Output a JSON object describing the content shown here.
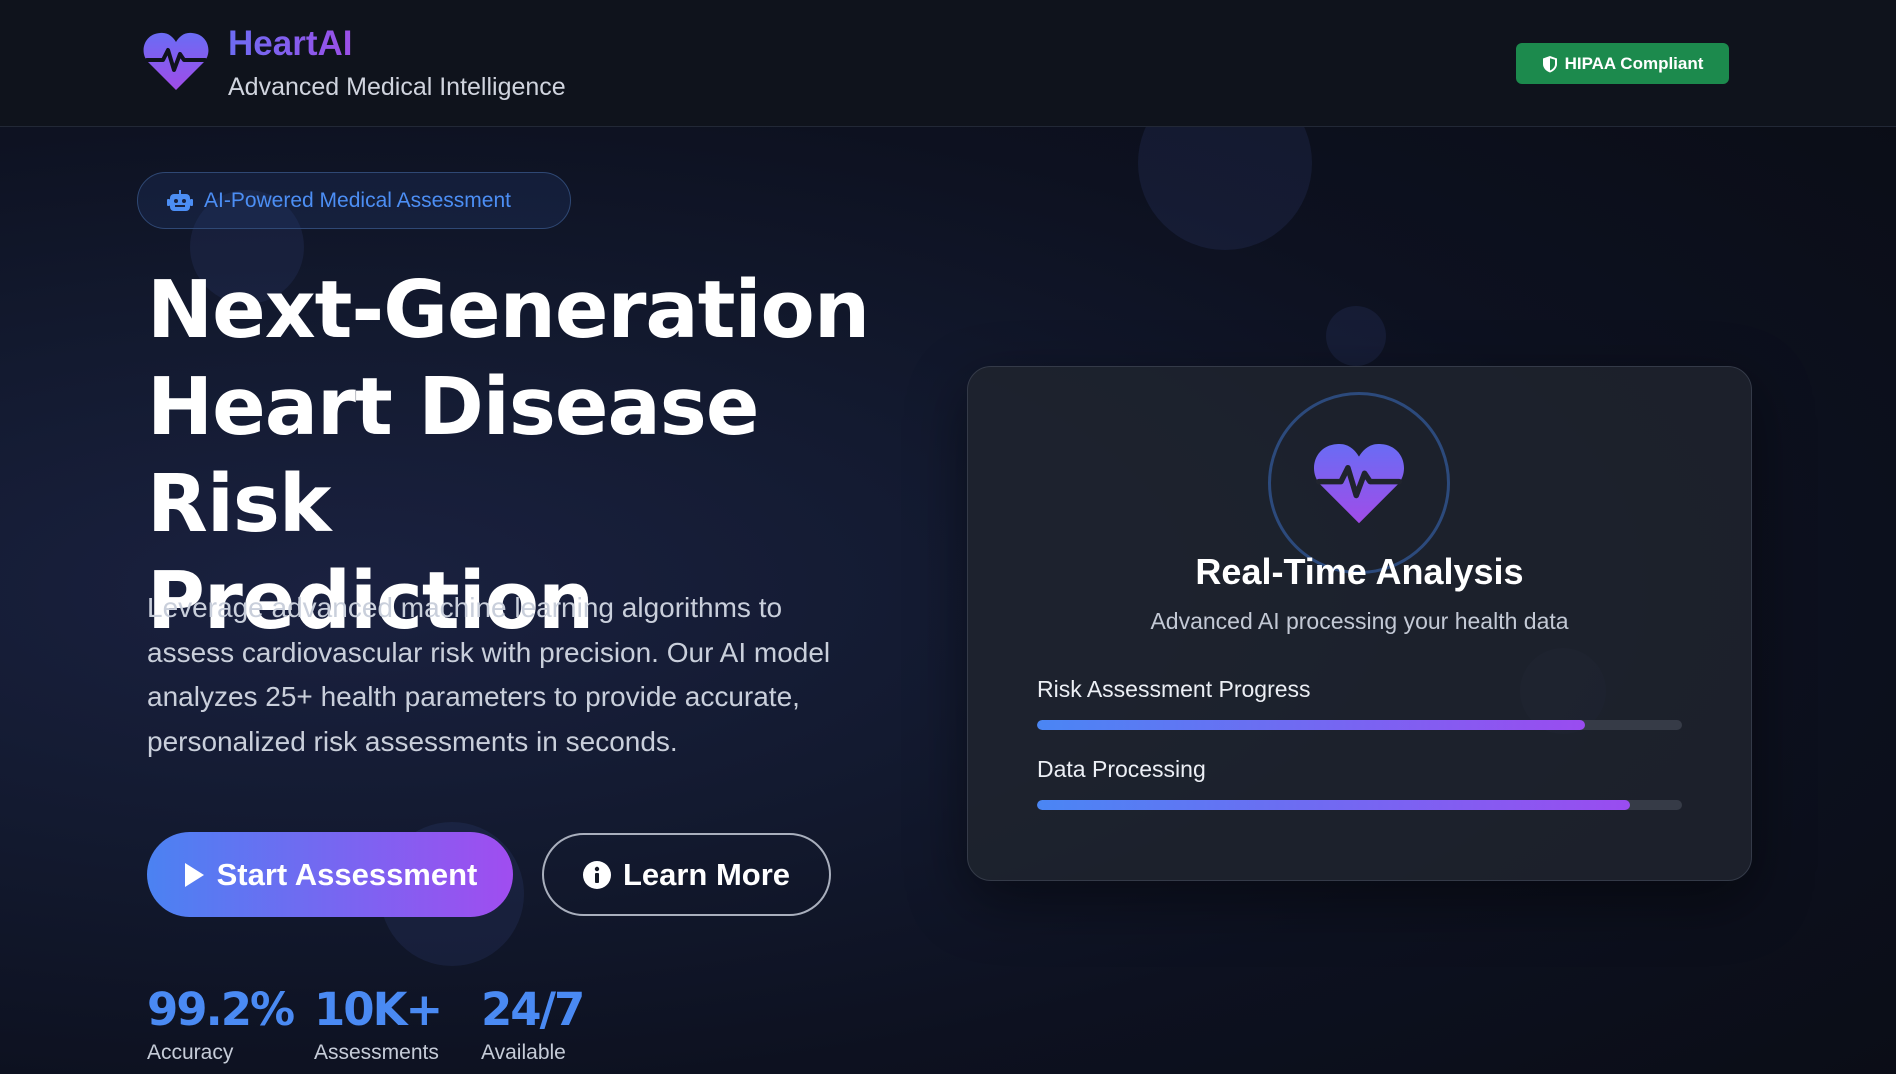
{
  "header": {
    "brand_name": "HeartAI",
    "brand_tagline": "Advanced Medical Intelligence",
    "badge": "HIPAA Compliant"
  },
  "hero": {
    "pill": "AI-Powered Medical Assessment",
    "headline": [
      "Next-Generation",
      "Heart Disease Risk",
      "Prediction"
    ],
    "description": "Leverage advanced machine learning algorithms to assess cardiovascular risk with precision. Our AI model analyzes 25+ health parameters to provide accurate, personalized risk assessments in seconds.",
    "primary_button": "Start Assessment",
    "secondary_button": "Learn More",
    "stats": [
      {
        "value": "99.2%",
        "label": "Accuracy"
      },
      {
        "value": "10K+",
        "label": "Assessments"
      },
      {
        "value": "24/7",
        "label": "Available"
      }
    ]
  },
  "card": {
    "title": "Real-Time Analysis",
    "subtitle": "Advanced AI processing your health data",
    "progress": [
      {
        "label": "Risk Assessment Progress",
        "percent": 85
      },
      {
        "label": "Data Processing",
        "percent": 92
      }
    ]
  },
  "colors": {
    "accent_blue": "#4a86f4",
    "accent_purple": "#9a4cf0",
    "badge_green": "#1c8a4d"
  },
  "icons": {
    "logo": "heart-pulse-icon",
    "badge": "shield-icon",
    "pill": "robot-icon",
    "primary_button": "play-icon",
    "secondary_button": "info-icon"
  }
}
